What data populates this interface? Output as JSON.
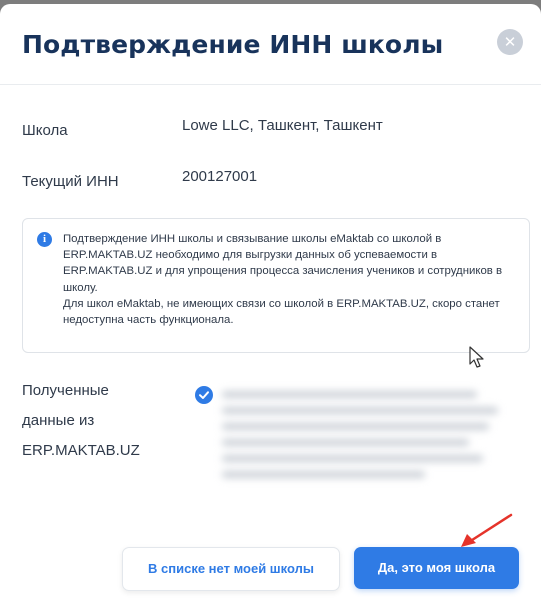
{
  "dialog": {
    "title": "Подтверждение ИНН школы",
    "close_icon": "close-icon"
  },
  "fields": {
    "school_label": "Школа",
    "school_value": "Lowe LLC, Ташкент, Ташкент",
    "inn_label": "Текущий ИНН",
    "inn_value": "200127001"
  },
  "info": {
    "icon": "info-icon",
    "paragraph1": "Подтверждение ИНН школы и связывание школы eMaktab со школой в ERP.MAKTAB.UZ необходимо для выгрузки данных об успеваемости в ERP.MAKTAB.UZ и для упрощения процесса зачисления учеников и сотрудников в школу.",
    "paragraph2": "Для школ eMaktab, не имеющих связи со школой в ERP.MAKTAB.UZ, скоро станет недоступна часть функционала."
  },
  "erp_data": {
    "label_line1": "Полученные",
    "label_line2": "данные из",
    "label_line3": "ERP.MAKTAB.UZ",
    "checked": true
  },
  "buttons": {
    "not_listed": "В списке нет моей школы",
    "confirm": "Да, это моя школа"
  },
  "colors": {
    "accent": "#2f7be5",
    "title": "#18335b",
    "annotation_arrow": "#e5332a"
  }
}
